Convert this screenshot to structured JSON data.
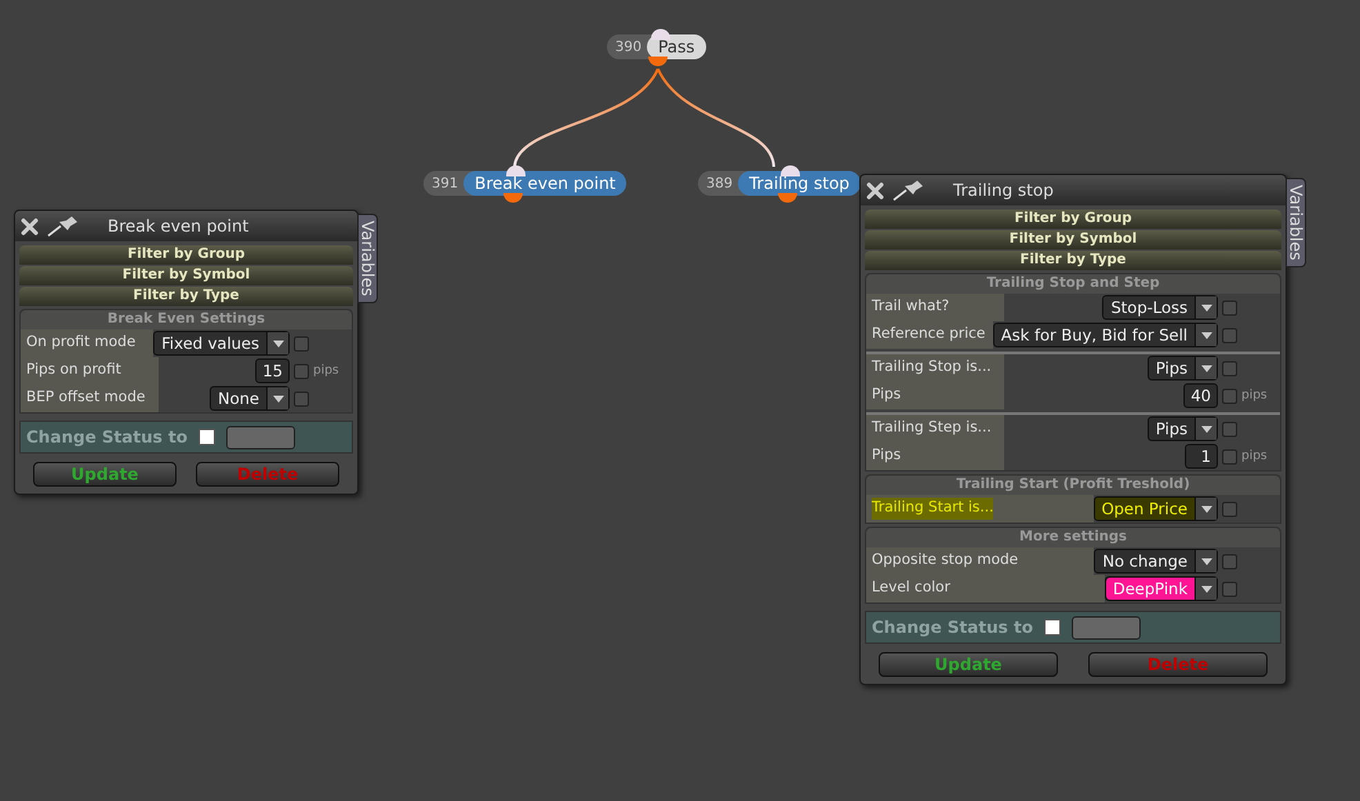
{
  "nodes": [
    {
      "number": "390",
      "label": "Pass",
      "kind": "plain"
    },
    {
      "number": "391",
      "label": "Break even point",
      "kind": "action"
    },
    {
      "number": "389",
      "label": "Trailing stop",
      "kind": "action"
    }
  ],
  "panels": [
    {
      "title": "Break even point",
      "tab": "Variables",
      "filters": [
        "Filter by Group",
        "Filter by Symbol",
        "Filter by Type"
      ],
      "sections": [
        {
          "title": "Break Even Settings",
          "groups": [
            [
              {
                "label": "On profit mode",
                "kind": "dropdown",
                "value": "Fixed values",
                "checked": false,
                "highlighted": false
              },
              {
                "label": "Pips on profit",
                "kind": "number",
                "value": "15",
                "unit": "pips",
                "checked": false,
                "highlighted": false
              },
              {
                "label": "BEP offset mode",
                "kind": "dropdown",
                "value": "None",
                "checked": false,
                "highlighted": false
              }
            ]
          ]
        }
      ],
      "status_label": "Change Status to",
      "status_checked": false,
      "buttons": [
        {
          "label": "Update",
          "kind": "update"
        },
        {
          "label": "Delete",
          "kind": "delete"
        }
      ]
    },
    {
      "title": "Trailing stop",
      "tab": "Variables",
      "filters": [
        "Filter by Group",
        "Filter by Symbol",
        "Filter by Type"
      ],
      "sections": [
        {
          "title": "Trailing Stop and Step",
          "groups": [
            [
              {
                "label": "Trail what?",
                "kind": "dropdown",
                "value": "Stop-Loss",
                "checked": false,
                "highlighted": false
              },
              {
                "label": "Reference price",
                "kind": "dropdown",
                "value": "Ask for Buy, Bid for Sell",
                "checked": false,
                "highlighted": false
              }
            ],
            [
              {
                "label": "Trailing Stop is...",
                "kind": "dropdown",
                "value": "Pips",
                "checked": false,
                "highlighted": false
              },
              {
                "label": "Pips",
                "kind": "number",
                "value": "40",
                "unit": "pips",
                "checked": false,
                "highlighted": false
              }
            ],
            [
              {
                "label": "Trailing Step is...",
                "kind": "dropdown",
                "value": "Pips",
                "checked": false,
                "highlighted": false
              },
              {
                "label": "Pips",
                "kind": "number",
                "value": "1",
                "unit": "pips",
                "checked": false,
                "highlighted": false
              }
            ]
          ]
        },
        {
          "title": "Trailing Start (Profit Treshold)",
          "groups": [
            [
              {
                "label": "Trailing Start is...",
                "kind": "dropdown",
                "value": "Open Price",
                "checked": false,
                "highlighted": true
              }
            ]
          ]
        },
        {
          "title": "More settings",
          "groups": [
            [
              {
                "label": "Opposite stop mode",
                "kind": "dropdown",
                "value": "No change",
                "checked": false,
                "highlighted": false
              },
              {
                "label": "Level color",
                "kind": "dropdown",
                "value": "DeepPink",
                "color": "#ff1493",
                "checked": false,
                "highlighted": false
              }
            ]
          ]
        }
      ],
      "status_label": "Change Status to",
      "status_checked": false,
      "buttons": [
        {
          "label": "Update",
          "kind": "update"
        },
        {
          "label": "Delete",
          "kind": "delete"
        }
      ]
    }
  ]
}
